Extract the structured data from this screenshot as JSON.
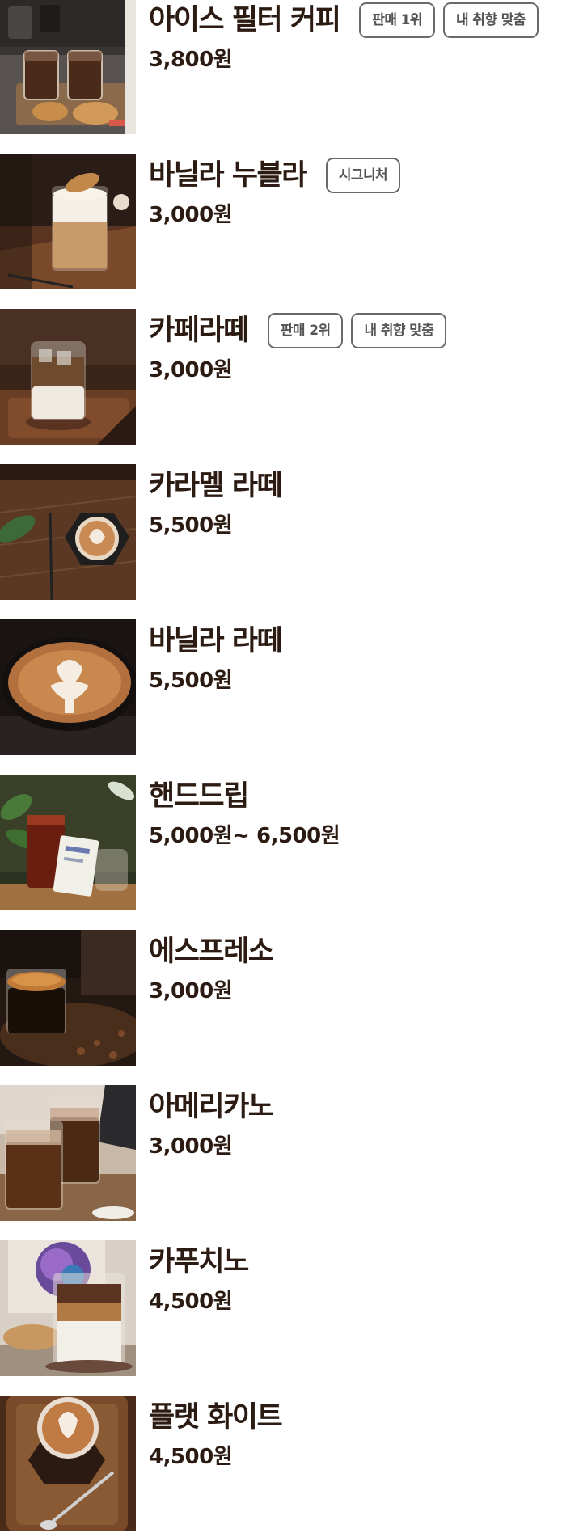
{
  "menu": {
    "items": [
      {
        "name": "아이스 필터 커피",
        "price": "3,800원",
        "tags": [
          "판매 1위",
          "내 취향 맞춤"
        ],
        "image": "iced-filter-coffee-photo"
      },
      {
        "name": "바닐라 누블라",
        "price": "3,000원",
        "tags": [
          "시그니처"
        ],
        "image": "vanilla-nubla-photo"
      },
      {
        "name": "카페라떼",
        "price": "3,000원",
        "tags": [
          "판매 2위",
          "내 취향 맞춤"
        ],
        "image": "cafe-latte-photo"
      },
      {
        "name": "카라멜 라떼",
        "price": "5,500원",
        "tags": [],
        "image": "caramel-latte-photo"
      },
      {
        "name": "바닐라 라떼",
        "price": "5,500원",
        "tags": [],
        "image": "vanilla-latte-photo"
      },
      {
        "name": "핸드드립",
        "price": "5,000원~ 6,500원",
        "tags": [],
        "image": "hand-drip-photo"
      },
      {
        "name": "에스프레소",
        "price": "3,000원",
        "tags": [],
        "image": "espresso-photo"
      },
      {
        "name": "아메리카노",
        "price": "3,000원",
        "tags": [],
        "image": "americano-photo"
      },
      {
        "name": "카푸치노",
        "price": "4,500원",
        "tags": [],
        "image": "cappuccino-photo"
      },
      {
        "name": "플랫 화이트",
        "price": "4,500원",
        "tags": [],
        "image": "flat-white-photo"
      }
    ]
  },
  "colors": {
    "text": "#2b1b12",
    "tag_border": "#6a6a6a",
    "tag_text": "#555555",
    "background": "#ffffff"
  }
}
